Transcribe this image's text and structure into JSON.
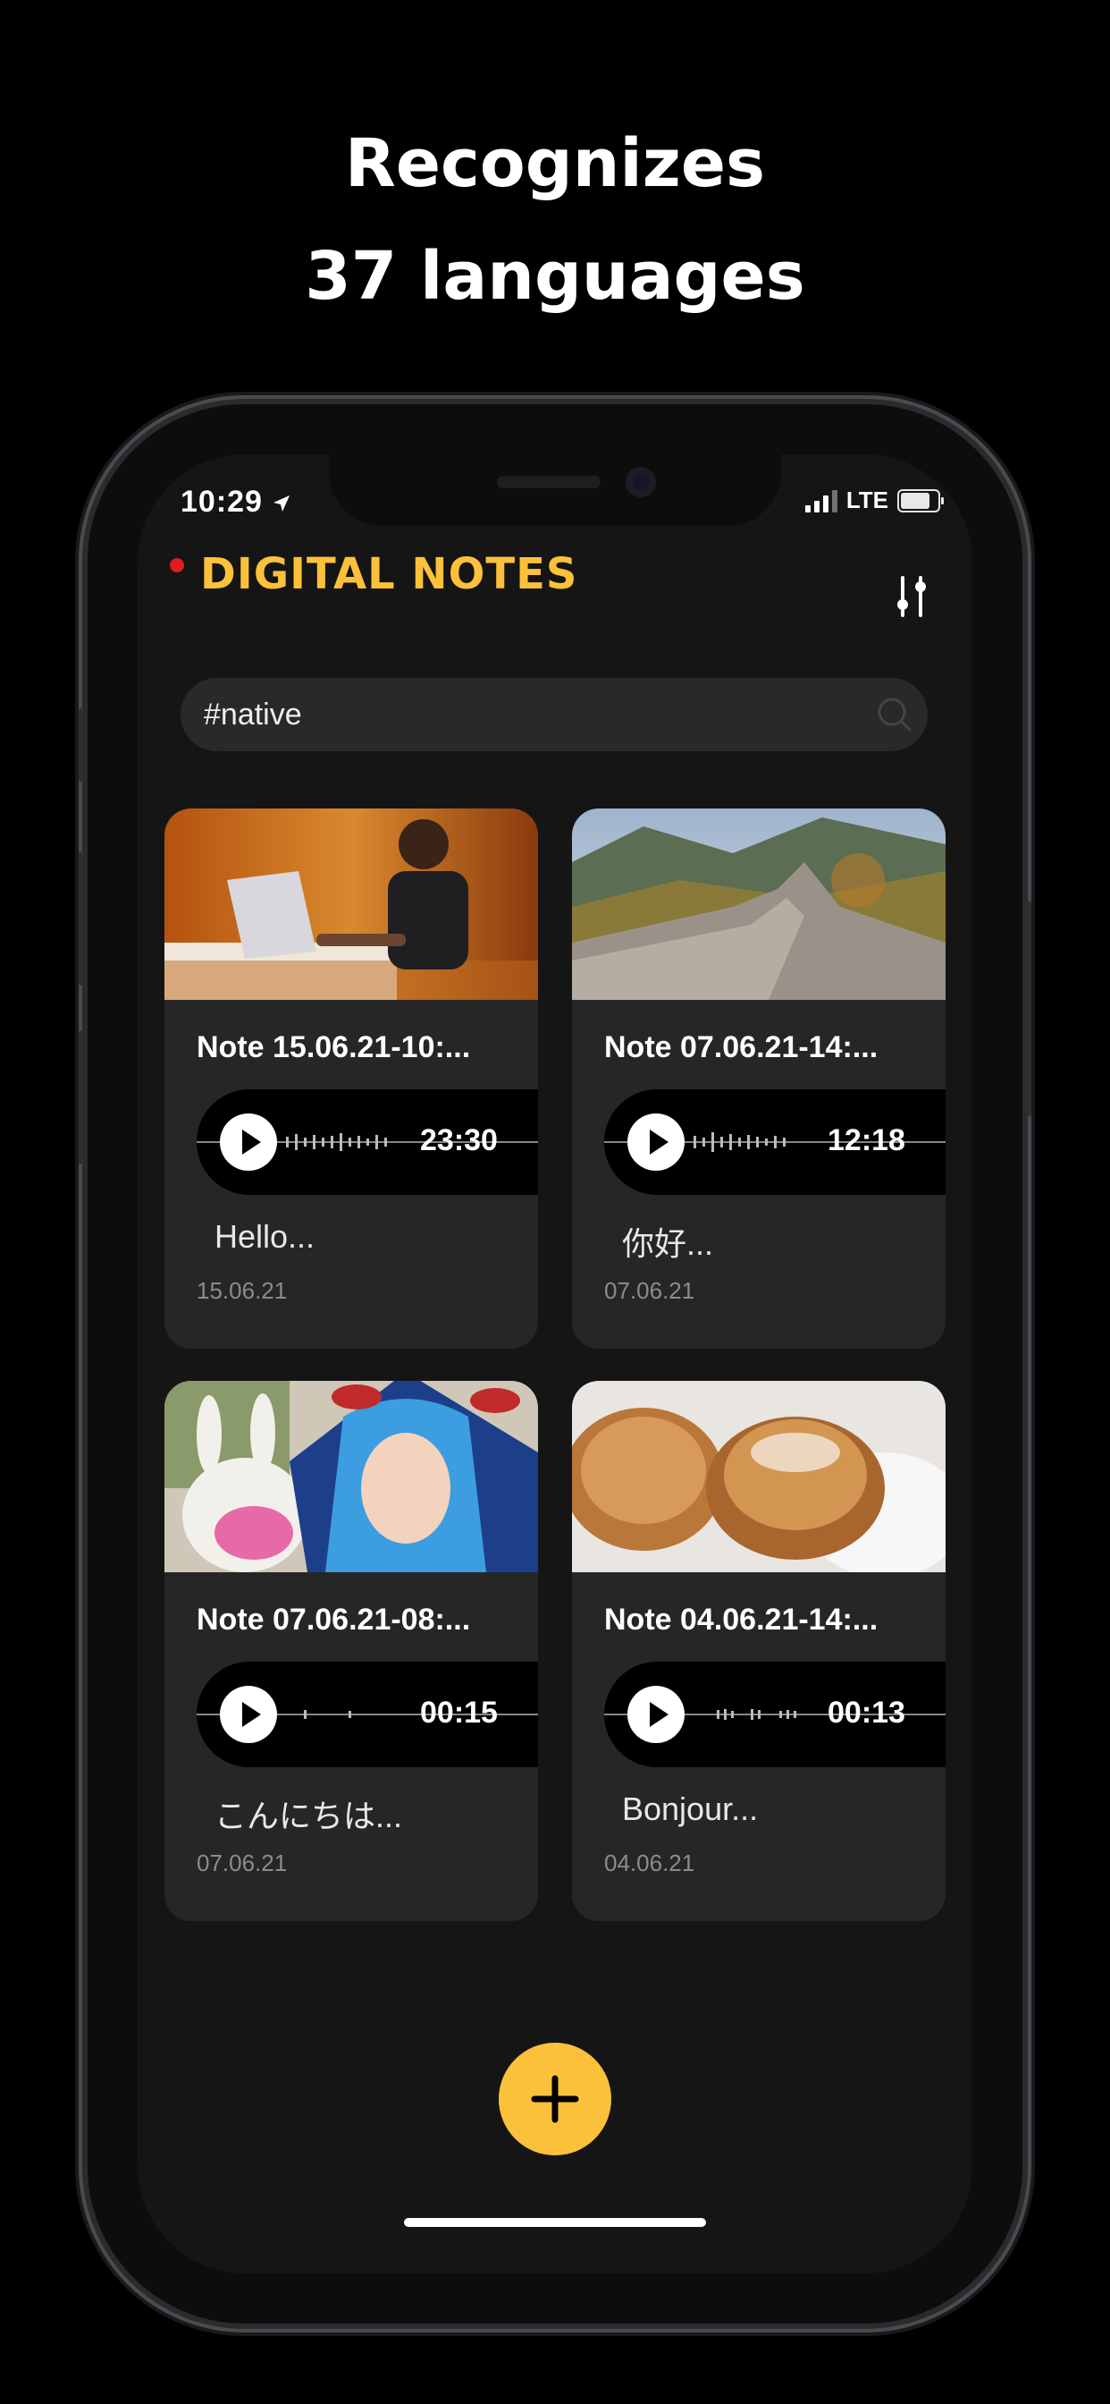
{
  "headline": {
    "line1": "Recognizes",
    "line2": "37 languages"
  },
  "status_bar": {
    "time": "10:29",
    "network": "LTE"
  },
  "app": {
    "title": "DIGITAL NOTES"
  },
  "search": {
    "value": "#native"
  },
  "notes": [
    {
      "title": "Note 15.06.21-10:...",
      "duration": "23:30",
      "snippet": "Hello...",
      "date": "15.06.21",
      "image": "person-laptop"
    },
    {
      "title": "Note 07.06.21-14:...",
      "duration": "12:18",
      "snippet": "你好...",
      "date": "07.06.21",
      "image": "great-wall"
    },
    {
      "title": "Note 07.06.21-08:...",
      "duration": "00:15",
      "snippet": "こんにちは...",
      "date": "07.06.21",
      "image": "cosplay-girl"
    },
    {
      "title": "Note 04.06.21-14:...",
      "duration": "00:13",
      "snippet": "Bonjour...",
      "date": "04.06.21",
      "image": "croissants"
    }
  ],
  "colors": {
    "accent": "#fcc13a",
    "record": "#e21b1b",
    "background": "#151515",
    "card": "#262626"
  },
  "icons": [
    "location-arrow-icon",
    "signal-icon",
    "battery-icon",
    "settings-sliders-icon",
    "search-icon",
    "play-icon",
    "plus-icon"
  ]
}
